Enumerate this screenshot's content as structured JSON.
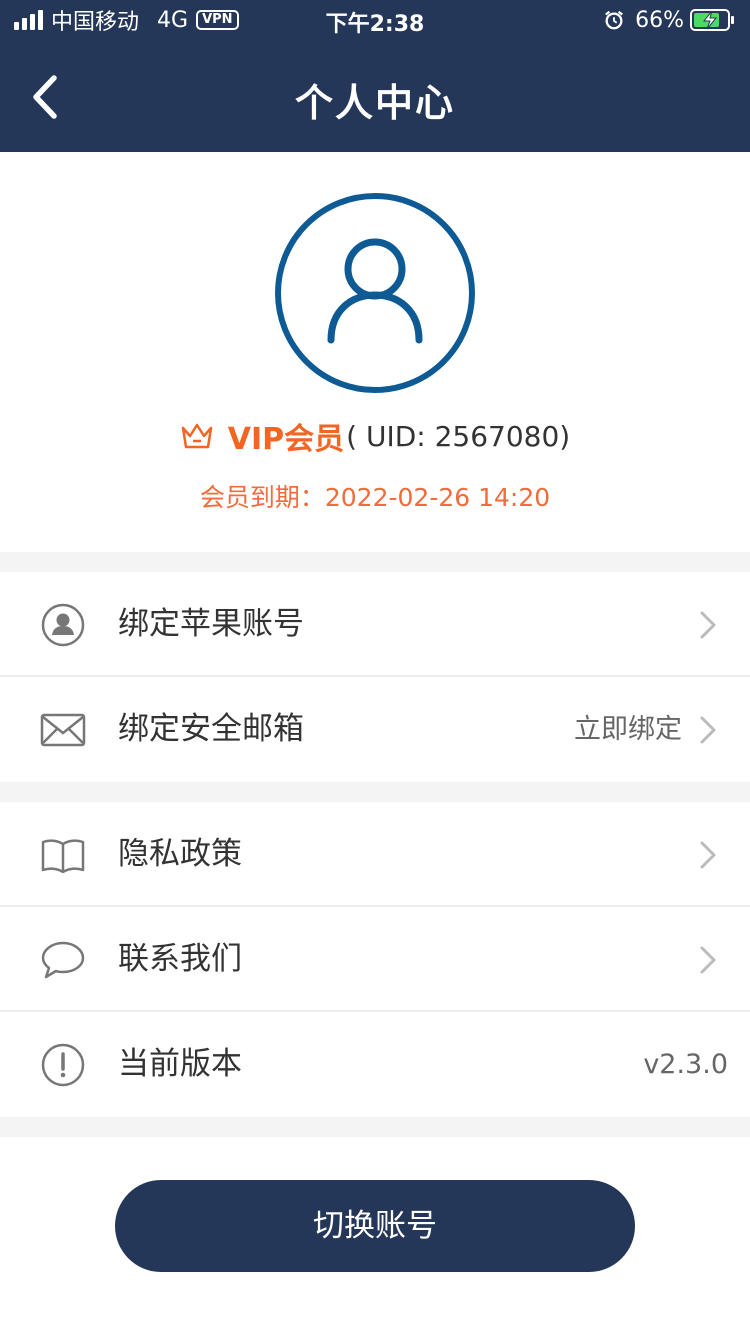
{
  "status_bar": {
    "carrier": "中国移动",
    "network": "4G",
    "vpn": "VPN",
    "time": "下午2:38",
    "battery": "66%"
  },
  "nav": {
    "title": "个人中心"
  },
  "profile": {
    "vip_label": "VIP会员",
    "uid": "( UID: 2567080)",
    "expire": "会员到期：2022-02-26 14:20"
  },
  "menu": {
    "apple": {
      "label": "绑定苹果账号"
    },
    "email": {
      "label": "绑定安全邮箱",
      "value": "立即绑定"
    },
    "privacy": {
      "label": "隐私政策"
    },
    "contact": {
      "label": "联系我们"
    },
    "version": {
      "label": "当前版本",
      "value": "v2.3.0"
    }
  },
  "button": {
    "switch_account": "切换账号"
  },
  "colors": {
    "primary": "#253759",
    "accent": "#f26522",
    "avatar_ring": "#0d5a94"
  }
}
